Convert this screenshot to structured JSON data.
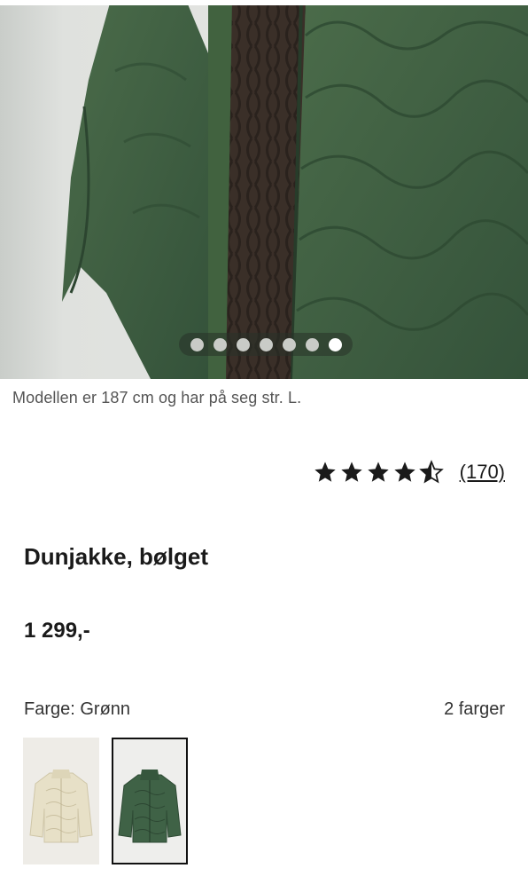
{
  "gallery": {
    "slide_count": 7,
    "active_slide": 7
  },
  "caption": "Modellen er 187 cm og har på seg str. L.",
  "rating": {
    "value": 4.5,
    "max": 5,
    "count_label": "(170)"
  },
  "product": {
    "title": "Dunjakke, bølget",
    "price": "1 299,-"
  },
  "colors": {
    "label": "Farge: Grønn",
    "count_label": "2 farger",
    "swatches": [
      {
        "name": "Beige",
        "hex": "#e7e0c7"
      },
      {
        "name": "Grønn",
        "hex": "#3f6246"
      }
    ]
  },
  "palette": {
    "jacket": "#3f5f3f",
    "sweater": "#3b3028",
    "text": "#1a1a1a"
  }
}
